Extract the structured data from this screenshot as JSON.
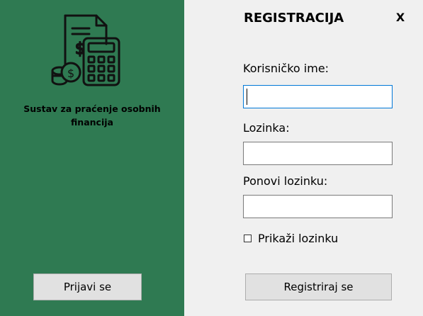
{
  "app": {
    "name": "Sustav za praćenje osobnih financija",
    "logo_icon": "finance-calculator-icon"
  },
  "form": {
    "title": "REGISTRACIJA",
    "close_label": "X",
    "username_label": "Korisničko ime:",
    "username_value": "",
    "password_label": "Lozinka:",
    "password_value": "",
    "repeat_password_label": "Ponovi lozinku:",
    "repeat_password_value": "",
    "show_password_label": "Prikaži lozinku",
    "show_password_checked": false,
    "register_button": "Registriraj se"
  },
  "login_button": "Prijavi se",
  "colors": {
    "left_panel": "#2f7a52",
    "right_panel": "#f0f0f0",
    "icon_stroke": "#111111"
  }
}
